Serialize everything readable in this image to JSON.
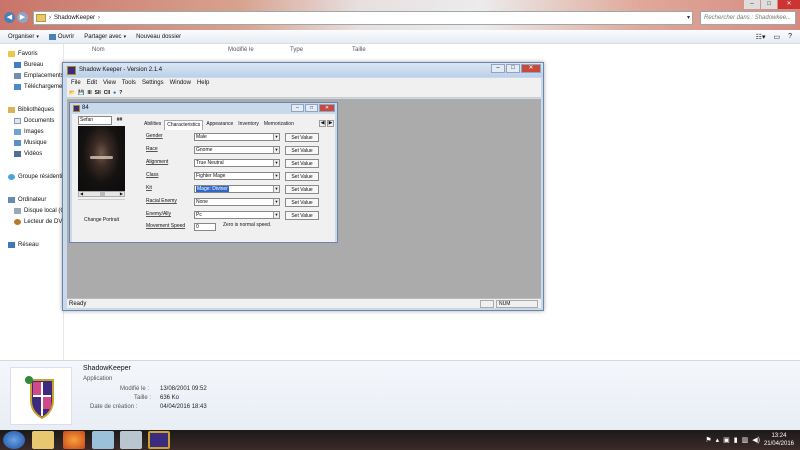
{
  "explorer": {
    "breadcrumb": "ShadowKeeper",
    "search_placeholder": "Rechercher dans : Shadowkee...",
    "window_buttons": [
      "–",
      "□",
      "✕"
    ],
    "toolbar": {
      "organize": "Organiser",
      "open": "Ouvrir",
      "share": "Partager avec",
      "new_folder": "Nouveau dossier"
    },
    "columns": [
      "Nom",
      "Modifié le",
      "Type",
      "Taille"
    ],
    "nav": {
      "favorites": "Favoris",
      "desktop": "Bureau",
      "locations": "Emplacements",
      "downloads": "Téléchargements",
      "libraries": "Bibliothèques",
      "documents": "Documents",
      "images": "Images",
      "music": "Musique",
      "videos": "Vidéos",
      "homegroup": "Groupe résidentiel",
      "computer": "Ordinateur",
      "local_disk": "Disque local (C:)",
      "dvd_drive": "Lecteur de DVD",
      "network": "Réseau"
    },
    "details": {
      "name": "ShadowKeeper",
      "kind": "Application",
      "modified_label": "Modifié le :",
      "modified_value": "13/08/2001 09:52",
      "size_label": "Taille :",
      "size_value": "636 Ko",
      "created_label": "Date de création :",
      "created_value": "04/04/2016 18:43"
    }
  },
  "shadowkeeper": {
    "title": "Shadow Keeper - Version 2.1.4",
    "menu": [
      "File",
      "Edit",
      "View",
      "Tools",
      "Settings",
      "Window",
      "Help"
    ],
    "toolbar": [
      "📂",
      "💾",
      "III",
      "SII",
      "CII",
      "●",
      "?"
    ],
    "status": {
      "ready": "Ready",
      "num": "NUM"
    },
    "child": {
      "title": "84",
      "name_value": "Sefan",
      "hash_button": "##",
      "change_portrait": "Change Portrait",
      "tabs": [
        "Abilities",
        "Characteristics",
        "Appearance",
        "Inventory",
        "Memorization"
      ],
      "active_tab": "Characteristics",
      "fields": {
        "gender": {
          "label": "Gender",
          "value": "Male"
        },
        "race": {
          "label": "Race",
          "value": "Gnome"
        },
        "alignment": {
          "label": "Alignment",
          "value": "True Neutral"
        },
        "class": {
          "label": "Class",
          "value": "Fighter Mage"
        },
        "kit": {
          "label": "Kit",
          "value": "Mage: Diviner"
        },
        "racial_enemy": {
          "label": "Racial Enemy",
          "value": "None"
        },
        "enemy_ally": {
          "label": "Enemy/Ally",
          "value": "Pc"
        }
      },
      "set_value_label": "Set Value",
      "movement_speed_label": "Movement Speed",
      "movement_speed_value": "0",
      "movement_speed_note": "Zero is normal speed."
    }
  },
  "taskbar": {
    "time": "13:24",
    "date": "21/04/2016"
  }
}
